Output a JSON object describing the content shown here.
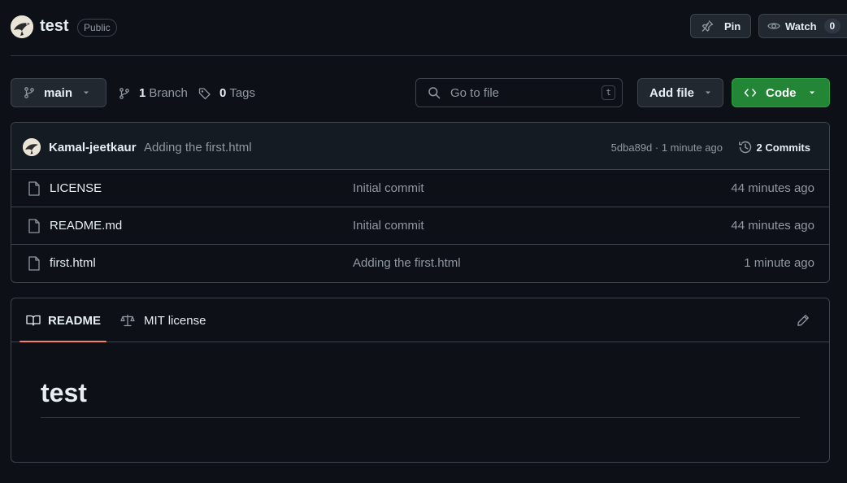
{
  "repo": {
    "name": "test",
    "visibility": "Public"
  },
  "header_actions": {
    "pin_label": "Pin",
    "watch_label": "Watch",
    "watch_count": "0"
  },
  "toolbar": {
    "branch": "main",
    "branch_count": "1",
    "branch_label": "Branch",
    "tag_count": "0",
    "tag_label": "Tags",
    "search_placeholder": "Go to file",
    "search_shortcut": "t",
    "add_file_label": "Add file",
    "code_label": "Code"
  },
  "latest_commit": {
    "author": "Kamal-jeetkaur",
    "message": "Adding the first.html",
    "meta": "5dba89d · 1 minute ago",
    "commits_count_label": "2 Commits"
  },
  "files": [
    {
      "name": "LICENSE",
      "message": "Initial commit",
      "time": "44 minutes ago"
    },
    {
      "name": "README.md",
      "message": "Initial commit",
      "time": "44 minutes ago"
    },
    {
      "name": "first.html",
      "message": "Adding the first.html",
      "time": "1 minute ago"
    }
  ],
  "readme": {
    "tab_readme": "README",
    "tab_license": "MIT license",
    "heading": "test"
  },
  "colors": {
    "background": "#0d1117",
    "border": "#3d444d",
    "accent_green": "#238636",
    "tab_underline": "#f78166",
    "muted_text": "#9198a1"
  }
}
